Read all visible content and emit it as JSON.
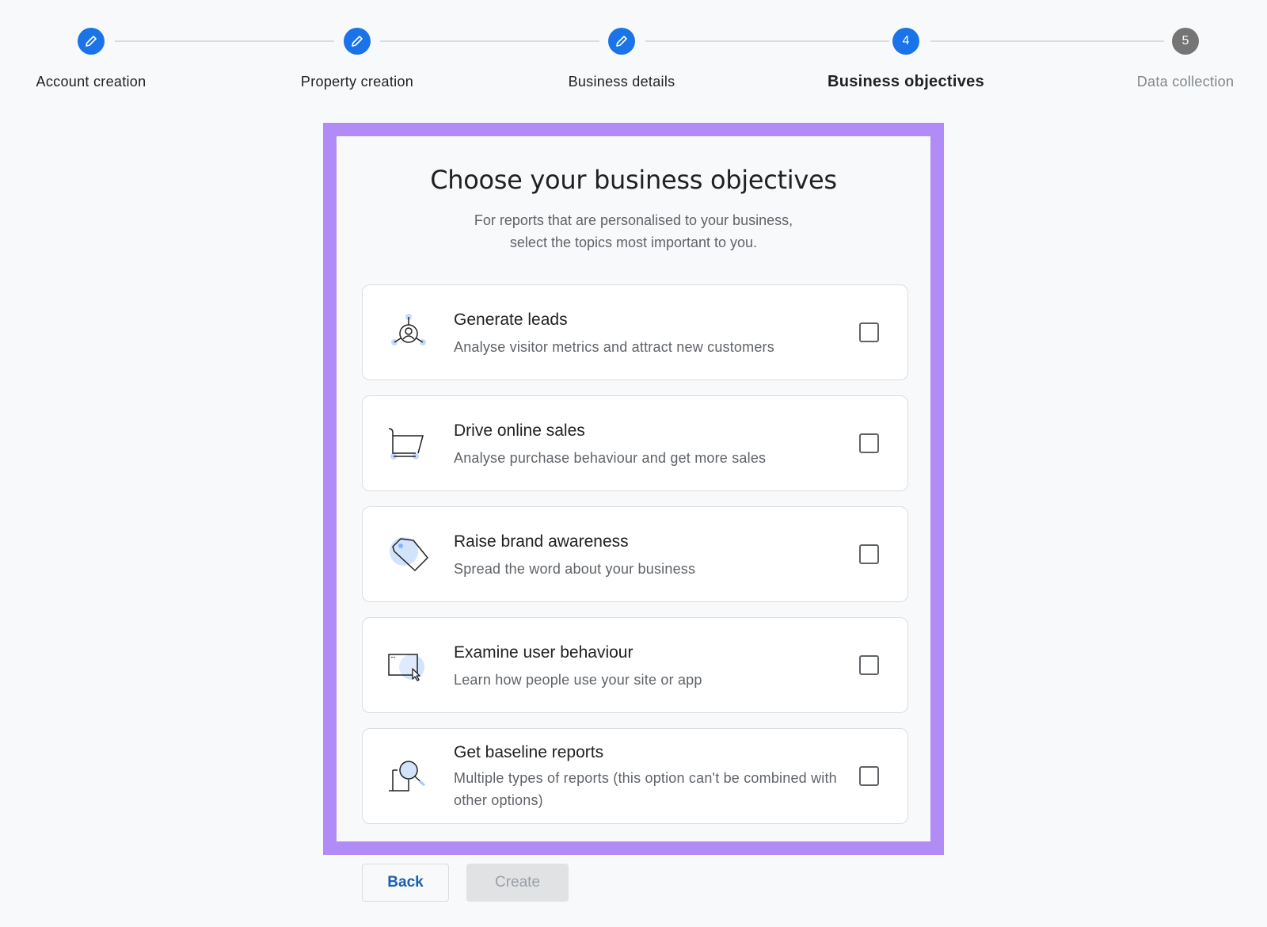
{
  "stepper": {
    "steps": [
      {
        "label": "Account creation",
        "state": "completed",
        "icon": "pencil-icon"
      },
      {
        "label": "Property creation",
        "state": "completed",
        "icon": "pencil-icon"
      },
      {
        "label": "Business details",
        "state": "completed",
        "icon": "pencil-icon"
      },
      {
        "label": "Business objectives",
        "state": "current",
        "number": "4"
      },
      {
        "label": "Data collection",
        "state": "pending",
        "number": "5"
      }
    ]
  },
  "main": {
    "title": "Choose your business objectives",
    "subtitle_line1": "For reports that are personalised to your business,",
    "subtitle_line2": "select the topics most important to you.",
    "options": [
      {
        "title": "Generate leads",
        "description": "Analyse visitor metrics and attract new customers",
        "icon": "leads-network-icon",
        "checked": false
      },
      {
        "title": "Drive online sales",
        "description": "Analyse purchase behaviour and get more sales",
        "icon": "shopping-cart-icon",
        "checked": false
      },
      {
        "title": "Raise brand awareness",
        "description": "Spread the word about your business",
        "icon": "tag-icon",
        "checked": false
      },
      {
        "title": "Examine user behaviour",
        "description": "Learn how people use your site or app",
        "icon": "browser-cursor-icon",
        "checked": false
      },
      {
        "title": "Get baseline reports",
        "description": "Multiple types of reports (this option can't be combined with other options)",
        "icon": "magnifier-report-icon",
        "checked": false
      }
    ]
  },
  "footer": {
    "back_label": "Back",
    "create_label": "Create"
  },
  "colors": {
    "accent": "#1a73e8",
    "highlight_frame": "#b18cf7",
    "pending_step": "#757575"
  }
}
